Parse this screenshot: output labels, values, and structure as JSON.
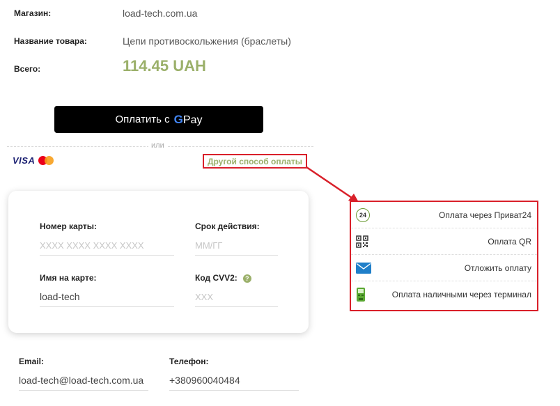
{
  "order": {
    "shop_label": "Магазин:",
    "shop_value": "load-tech.com.ua",
    "product_label": "Название товара:",
    "product_value": "Цепи противоскольжения (браслеты)",
    "total_label": "Всего:",
    "total_value": "114.45 UAH"
  },
  "gpay": {
    "label": "Оплатить с",
    "g": "G",
    "pay": "Pay"
  },
  "divider": {
    "or": "или"
  },
  "card_brands": {
    "visa": "VISA"
  },
  "other_method_link": "Другой способ оплаты",
  "card_form": {
    "number_label": "Номер карты:",
    "number_placeholder": "XXXX XXXX XXXX XXXX",
    "expiry_label": "Срок действия:",
    "expiry_placeholder": "ММ/ГГ",
    "name_label": "Имя на карте:",
    "name_value": "load-tech",
    "cvv_label": "Код CVV2:",
    "cvv_placeholder": "XXX",
    "help_glyph": "?"
  },
  "payment_methods": [
    {
      "label": "Оплата через Приват24",
      "icon": "privat24-icon",
      "icon_text": "24"
    },
    {
      "label": "Оплата QR",
      "icon": "qr-code-icon"
    },
    {
      "label": "Отложить оплату",
      "icon": "envelope-icon"
    },
    {
      "label": "Оплата наличными через терминал",
      "icon": "terminal-icon"
    }
  ],
  "contact": {
    "email_label": "Email:",
    "email_value": "load-tech@load-tech.com.ua",
    "phone_label": "Телефон:",
    "phone_value": "+380960040484"
  },
  "colors": {
    "accent": "#9bb06a",
    "highlight": "#d9202a",
    "button": "#000000"
  }
}
